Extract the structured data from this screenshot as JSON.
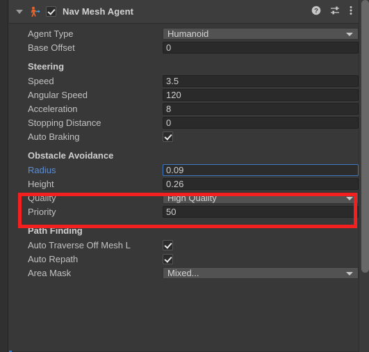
{
  "component": {
    "title": "Nav Mesh Agent",
    "enabled": true,
    "expanded": true,
    "icon": "nav-mesh-agent-icon",
    "header_icons": [
      {
        "name": "help-icon",
        "label": "?"
      },
      {
        "name": "preset-icon",
        "label": "presets"
      },
      {
        "name": "more-menu-icon",
        "label": "more"
      }
    ]
  },
  "fields": {
    "agent_type": {
      "label": "Agent Type",
      "value": "Humanoid",
      "type": "dropdown"
    },
    "base_offset": {
      "label": "Base Offset",
      "value": "0",
      "type": "text"
    },
    "speed": {
      "label": "Speed",
      "value": "3.5",
      "type": "text"
    },
    "angular_speed": {
      "label": "Angular Speed",
      "value": "120",
      "type": "text"
    },
    "acceleration": {
      "label": "Acceleration",
      "value": "8",
      "type": "text"
    },
    "stopping_distance": {
      "label": "Stopping Distance",
      "value": "0",
      "type": "text"
    },
    "auto_braking": {
      "label": "Auto Braking",
      "value": true,
      "type": "checkbox"
    },
    "radius": {
      "label": "Radius",
      "value": "0.09",
      "type": "text",
      "focused": true,
      "modified": true
    },
    "height": {
      "label": "Height",
      "value": "0.26",
      "type": "text"
    },
    "quality": {
      "label": "Quality",
      "value": "High Quality",
      "type": "dropdown"
    },
    "priority": {
      "label": "Priority",
      "value": "50",
      "type": "text"
    },
    "auto_traverse": {
      "label": "Auto Traverse Off Mesh L",
      "value": true,
      "type": "checkbox"
    },
    "auto_repath": {
      "label": "Auto Repath",
      "value": true,
      "type": "checkbox"
    },
    "area_mask": {
      "label": "Area Mask",
      "value": "Mixed...",
      "type": "dropdown"
    }
  },
  "sections": {
    "steering": "Steering",
    "obstacle_avoidance": "Obstacle Avoidance",
    "path_finding": "Path Finding"
  },
  "colors": {
    "panel_bg": "#383838",
    "header_bg": "#3d3d3d",
    "field_bg": "#2a2a2a",
    "dropdown_bg": "#525252",
    "label": "#c2c2c2",
    "modified_label": "#5b8ed6",
    "focus_border": "#3e79c8",
    "annotation": "#f42020",
    "agent_icon_orange": "#e8622a",
    "agent_icon_blue": "#3aa8e0"
  }
}
